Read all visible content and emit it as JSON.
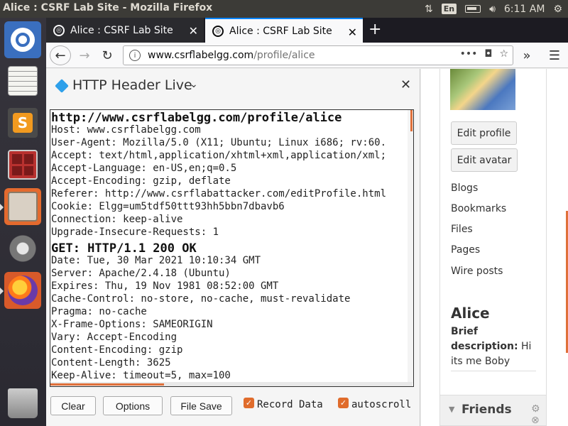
{
  "system_bar": {
    "window_title": "Alice : CSRF Lab Site - Mozilla Firefox",
    "lang": "En",
    "clock": "6:11 AM"
  },
  "tabs": [
    {
      "label": "Alice : CSRF Lab Site",
      "active": false
    },
    {
      "label": "Alice : CSRF Lab Site",
      "active": true
    }
  ],
  "navbar": {
    "url_host": "www.csrflabelgg.com",
    "url_path": "/profile/alice"
  },
  "sidebar": {
    "title": "HTTP Header Live",
    "log_lines": [
      {
        "text": "http://www.csrflabelgg.com/profile/alice",
        "header": true
      },
      {
        "text": "Host: www.csrflabelgg.com",
        "header": false
      },
      {
        "text": "User-Agent: Mozilla/5.0 (X11; Ubuntu; Linux i686; rv:60.",
        "header": false
      },
      {
        "text": "Accept: text/html,application/xhtml+xml,application/xml;",
        "header": false
      },
      {
        "text": "Accept-Language: en-US,en;q=0.5",
        "header": false
      },
      {
        "text": "Accept-Encoding: gzip, deflate",
        "header": false
      },
      {
        "text": "Referer: http://www.csrflabattacker.com/editProfile.html",
        "header": false
      },
      {
        "text": "Cookie: Elgg=um5tdf50ttt93hh5bbn7dbavb6",
        "header": false
      },
      {
        "text": "Connection: keep-alive",
        "header": false
      },
      {
        "text": "Upgrade-Insecure-Requests: 1",
        "header": false
      },
      {
        "text": "GET: HTTP/1.1 200 OK",
        "header": true
      },
      {
        "text": "Date: Tue, 30 Mar 2021 10:10:34 GMT",
        "header": false
      },
      {
        "text": "Server: Apache/2.4.18 (Ubuntu)",
        "header": false
      },
      {
        "text": "Expires: Thu, 19 Nov 1981 08:52:00 GMT",
        "header": false
      },
      {
        "text": "Cache-Control: no-store, no-cache, must-revalidate",
        "header": false
      },
      {
        "text": "Pragma: no-cache",
        "header": false
      },
      {
        "text": "X-Frame-Options: SAMEORIGIN",
        "header": false
      },
      {
        "text": "Vary: Accept-Encoding",
        "header": false
      },
      {
        "text": "Content-Encoding: gzip",
        "header": false
      },
      {
        "text": "Content-Length: 3625",
        "header": false
      },
      {
        "text": "Keep-Alive: timeout=5, max=100",
        "header": false
      }
    ],
    "buttons": {
      "clear": "Clear",
      "options": "Options",
      "file_save": "File Save"
    },
    "checkboxes": {
      "record_data": {
        "label": "Record Data",
        "checked": true
      },
      "autoscroll": {
        "label": "autoscroll",
        "checked": true
      }
    }
  },
  "profile": {
    "edit_profile": "Edit profile",
    "edit_avatar": "Edit avatar",
    "links": [
      "Blogs",
      "Bookmarks",
      "Files",
      "Pages",
      "Wire posts"
    ],
    "name": "Alice",
    "desc_label": "Brief description:",
    "desc_value": " Hi its me Boby",
    "friends_title": "Friends"
  },
  "colors": {
    "accent_orange": "#e0703a",
    "tab_active_indicator": "#0a84ff",
    "ubuntu_bar": "#3c3b37"
  }
}
